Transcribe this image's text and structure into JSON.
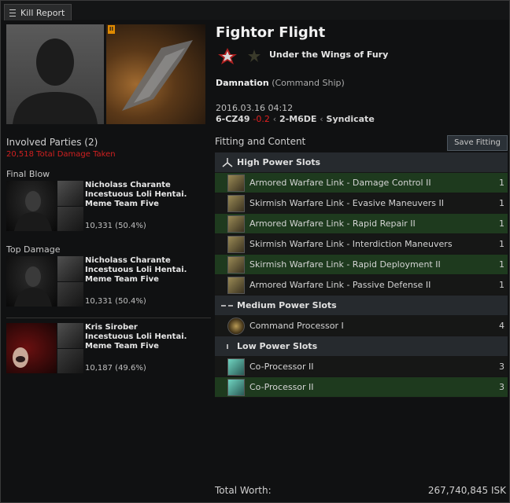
{
  "window": {
    "tab_label": "Kill Report"
  },
  "victim": {
    "ship_name": "Fightor Flight",
    "corp_name": "Under the Wings of Fury",
    "ship_type_name": "Damnation",
    "ship_type_class": "(Command Ship)",
    "datetime": "2016.03.16 04:12",
    "system": "6-CZ49",
    "security": "-0.2",
    "constellation": "2-M6DE",
    "region": "Syndicate",
    "tech_badge": "II"
  },
  "involved": {
    "heading": "Involved Parties (2)",
    "total_damage": "20,518 Total Damage Taken",
    "final_blow_label": "Final Blow",
    "top_damage_label": "Top Damage",
    "parties": [
      {
        "name": "Nicholass Charante",
        "corp": "Incestuous Loli Hentai.",
        "alliance": "Meme Team Five",
        "damage": "10,331 (50.4%)"
      },
      {
        "name": "Nicholass Charante",
        "corp": "Incestuous Loli Hentai.",
        "alliance": "Meme Team Five",
        "damage": "10,331 (50.4%)"
      },
      {
        "name": "Kris Sirober",
        "corp": "Incestuous Loli Hentai.",
        "alliance": "Meme Team Five",
        "damage": "10,187 (49.6%)"
      }
    ]
  },
  "fitting": {
    "heading": "Fitting and Content",
    "save_label": "Save Fitting",
    "high_label": "High Power Slots",
    "high": [
      {
        "name": "Armored Warfare Link - Damage Control II",
        "qty": "1"
      },
      {
        "name": "Skirmish Warfare Link - Evasive Maneuvers II",
        "qty": "1"
      },
      {
        "name": "Armored Warfare Link - Rapid Repair II",
        "qty": "1"
      },
      {
        "name": "Skirmish Warfare Link - Interdiction Maneuvers",
        "qty": "1"
      },
      {
        "name": "Skirmish Warfare Link - Rapid Deployment II",
        "qty": "1"
      },
      {
        "name": "Armored Warfare Link - Passive Defense II",
        "qty": "1"
      }
    ],
    "medium_label": "Medium Power Slots",
    "medium": [
      {
        "name": "Command Processor I",
        "qty": "4"
      }
    ],
    "low_label": "Low Power Slots",
    "low": [
      {
        "name": "Co-Processor II",
        "qty": "3"
      },
      {
        "name": "Co-Processor II",
        "qty": "3"
      }
    ]
  },
  "total": {
    "label": "Total Worth:",
    "value": "267,740,845 ISK"
  }
}
